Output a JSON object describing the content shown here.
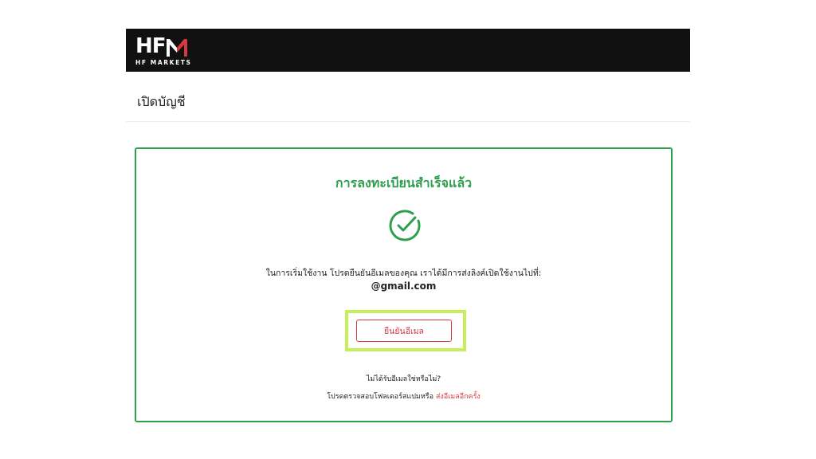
{
  "header": {
    "logo_mark": "HF",
    "logo_subtitle": "HF MARKETS"
  },
  "page": {
    "title": "เปิดบัญชี"
  },
  "card": {
    "success_title": "การลงทะเบียนสำเร็จแล้ว",
    "icon": "check-circle-icon",
    "message": "ในการเริ่มใช้งาน โปรดยืนยันอีเมลของคุณ เราได้มีการส่งลิงค์เปิดใช้งานไปที่:",
    "email": "@gmail.com",
    "verify_button_label": "ยืนยันอีเมล",
    "not_received_text": "ไม่ได้รับอีเมลใช่หรือไม่?",
    "check_spam_text": "โปรดตรวจสอบโฟลเดอร์สแปมหรือ ",
    "resend_link_label": "ส่งอีเมลอีกครั้ง"
  },
  "colors": {
    "header_bg": "#111111",
    "accent_green": "#2e9e4f",
    "accent_red": "#d9383e",
    "highlight": "#c6ef5a"
  }
}
